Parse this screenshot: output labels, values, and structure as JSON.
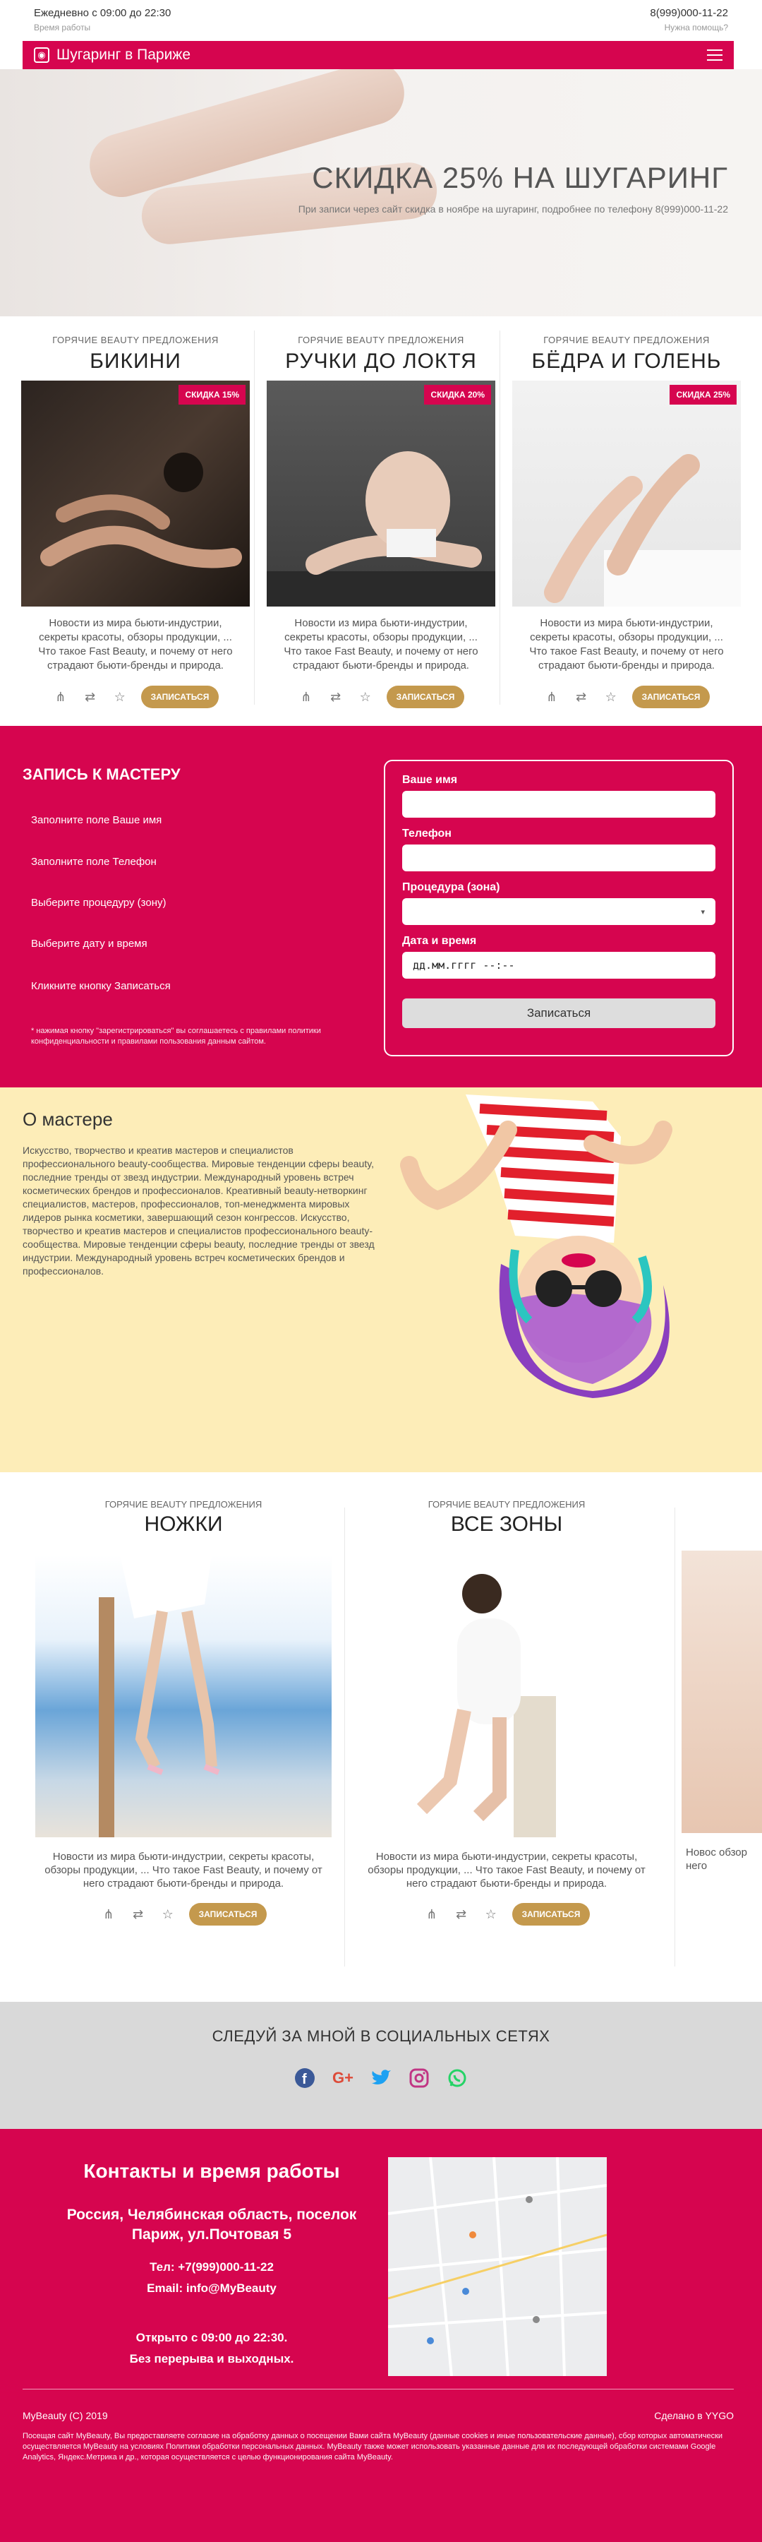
{
  "topbar": {
    "hours": "Ежедневно с 09:00 до 22:30",
    "hours_label": "Время работы",
    "phone": "8(999)000-11-22",
    "help": "Нужна помощь?"
  },
  "nav": {
    "brand": "Шугаринг в Париже"
  },
  "hero": {
    "title": "СКИДКА 25% НА ШУГАРИНГ",
    "subtitle": "При записи через сайт скидка в ноябре на шугаринг, подробнее по телефону 8(999)000-11-22"
  },
  "offers": [
    {
      "kicker": "ГОРЯЧИЕ BEAUTY ПРЕДЛОЖЕНИЯ",
      "title": "БИКИНИ",
      "badge": "СКИДКА 15%",
      "desc": "Новости из мира бьюти-индустрии, секреты красоты, обзоры продукции, ... Что такое Fast Beauty, и почему от него страдают бьюти-бренды и природа.",
      "button": "ЗАПИСАТЬСЯ"
    },
    {
      "kicker": "ГОРЯЧИЕ BEAUTY ПРЕДЛОЖЕНИЯ",
      "title": "РУЧКИ ДО ЛОКТЯ",
      "badge": "СКИДКА 20%",
      "desc": "Новости из мира бьюти-индустрии, секреты красоты, обзоры продукции, ... Что такое Fast Beauty, и почему от него страдают бьюти-бренды и природа.",
      "button": "ЗАПИСАТЬСЯ"
    },
    {
      "kicker": "ГОРЯЧИЕ BEAUTY ПРЕДЛОЖЕНИЯ",
      "title": "БЁДРА И ГОЛЕНЬ",
      "badge": "СКИДКА 25%",
      "desc": "Новости из мира бьюти-индустрии, секреты красоты, обзоры продукции, ... Что такое Fast Beauty, и почему от него страдают бьюти-бренды и природа.",
      "button": "ЗАПИСАТЬСЯ"
    }
  ],
  "booking": {
    "title": "ЗАПИСЬ К МАСТЕРУ",
    "steps": [
      "Заполните поле Ваше имя",
      "Заполните поле Телефон",
      "Выберите процедуру (зону)",
      "Выберите дату и время",
      "Кликните кнопку Записаться"
    ],
    "note": "* нажимая кнопку \"зарегистрироваться\" вы соглашаетесь с правилами политики конфиденциальности и правилами пользования данным сайтом.",
    "form": {
      "name_label": "Ваше имя",
      "phone_label": "Телефон",
      "procedure_label": "Процедура (зона)",
      "datetime_label": "Дата и время",
      "datetime_placeholder": "дд.мм.гггг --:--",
      "submit": "Записаться"
    }
  },
  "about": {
    "title": "О мастере",
    "text": "Искусство, творчество и креатив мастеров и специалистов профессионального beauty-сообщества. Мировые тенденции сферы beauty, последние тренды от звезд индустрии. Международный уровень встреч косметических брендов и профессионалов. Креативный beauty-нетворкинг специалистов, мастеров, профессионалов, топ-менеджмента мировых лидеров рынка косметики, завершающий сезон конгрессов. Искусство, творчество и креатив мастеров и специалистов профессионального beauty-сообщества. Мировые тенденции сферы beauty, последние тренды от звезд индустрии. Международный уровень встреч косметических брендов и профессионалов."
  },
  "offers2": [
    {
      "kicker": "ГОРЯЧИЕ BEAUTY ПРЕДЛОЖЕНИЯ",
      "title": "НОЖКИ",
      "desc": "Новости из мира бьюти-индустрии, секреты красоты, обзоры продукции, ... Что такое Fast Beauty, и почему от него страдают бьюти-бренды и природа.",
      "button": "ЗАПИСАТЬСЯ"
    },
    {
      "kicker": "ГОРЯЧИЕ BEAUTY ПРЕДЛОЖЕНИЯ",
      "title": "ВСЕ ЗОНЫ",
      "desc": "Новости из мира бьюти-индустрии, секреты красоты, обзоры продукции, ... Что такое Fast Beauty, и почему от него страдают бьюти-бренды и природа.",
      "button": "ЗАПИСАТЬСЯ"
    },
    {
      "desc_partial": "Новос обзор него"
    }
  ],
  "social": {
    "title": "СЛЕДУЙ ЗА МНОЙ В СОЦИАЛЬНЫХ СЕТЯХ",
    "icons": [
      "facebook-icon",
      "google-plus-icon",
      "twitter-icon",
      "instagram-icon",
      "whatsapp-icon"
    ]
  },
  "contacts": {
    "title": "Контакты и время работы",
    "address": "Россия, Челябинская область, поселок Париж, ул.Почтовая 5",
    "phone": "Тел: +7(999)000-11-22",
    "email": "Email: info@MyBeauty",
    "open": "Открыто с 09:00 до 22:30.",
    "nobreak": "Без перерыва и выходных.",
    "copyright": "MyBeauty (C) 2019",
    "made": "Сделано в YYGO",
    "legal": "Посещая сайт MyBeauty, Вы предоставляете согласие на обработку данных о посещении Вами сайта MyBeauty (данные cookies и иные пользовательские данные), сбор которых автоматически осуществляется MyBeauty на условиях Политики обработки персональных данных. MyBeauty также может использовать указанные данные для их последующей обработки системами Google Analytics, Яндекс.Метрика и др., которая осуществляется с целью функционирования сайта MyBeauty."
  },
  "colors": {
    "brand": "#d6054f",
    "gold": "#c4994d",
    "about_bg": "#fdedb8",
    "social_bg": "#d9d9d9"
  }
}
